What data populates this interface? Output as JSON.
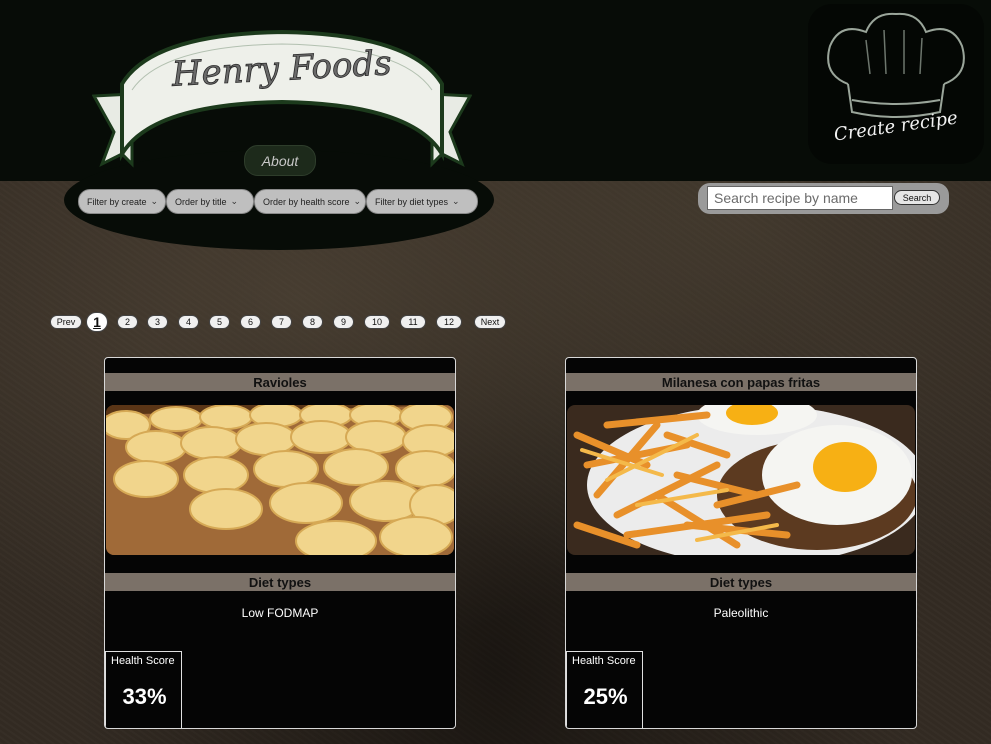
{
  "logo": {
    "text": "Henry Foods"
  },
  "nav": {
    "about_label": "About"
  },
  "filters": [
    {
      "label": "Filter by create"
    },
    {
      "label": "Order by title"
    },
    {
      "label": "Order by health score"
    },
    {
      "label": "Filter by diet types"
    }
  ],
  "create": {
    "label": "Create recipe"
  },
  "search": {
    "placeholder": "Search recipe by name",
    "value": "",
    "button_label": "Search"
  },
  "pagination": {
    "prev_label": "Prev",
    "next_label": "Next",
    "pages": [
      "1",
      "2",
      "3",
      "4",
      "5",
      "6",
      "7",
      "8",
      "9",
      "10",
      "11",
      "12"
    ],
    "current": "1"
  },
  "recipes": [
    {
      "title": "Ravioles",
      "diet_header": "Diet types",
      "diets": "Low FODMAP",
      "health_label": "Health Score",
      "health_score": "33%"
    },
    {
      "title": "Milanesa con papas fritas",
      "diet_header": "Diet types",
      "diets": "Paleolithic",
      "health_label": "Health Score",
      "health_score": "25%"
    }
  ],
  "colors": {
    "header_bg": "#070c07",
    "card_bar": "#7b7168",
    "page_bg": "#332b23"
  }
}
